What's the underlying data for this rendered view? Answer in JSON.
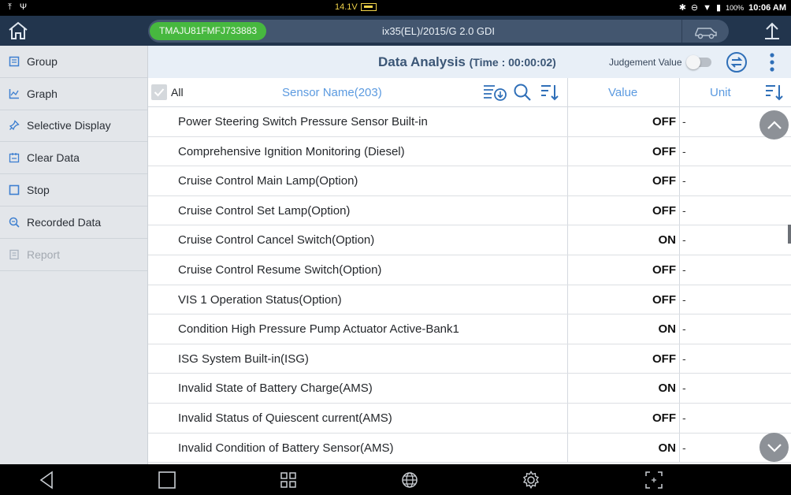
{
  "status_bar": {
    "voltage": "14.1V",
    "battery": "100%",
    "time": "10:06 AM"
  },
  "vehicle": {
    "vin": "TMAJU81FMFJ733883",
    "name": "ix35(EL)/2015/G 2.0 GDI"
  },
  "sidebar": {
    "items": [
      {
        "label": "Group",
        "icon": "group-icon",
        "disabled": false
      },
      {
        "label": "Graph",
        "icon": "graph-icon",
        "disabled": false
      },
      {
        "label": "Selective Display",
        "icon": "pin-icon",
        "disabled": false
      },
      {
        "label": "Clear Data",
        "icon": "clear-data-icon",
        "disabled": false
      },
      {
        "label": "Stop",
        "icon": "stop-icon",
        "disabled": false
      },
      {
        "label": "Recorded Data",
        "icon": "recorded-data-icon",
        "disabled": false
      },
      {
        "label": "Report",
        "icon": "report-icon",
        "disabled": true
      }
    ]
  },
  "header": {
    "title": "Data Analysis",
    "time_label": "(Time : 00:00:02)",
    "judgement_label": "Judgement Value",
    "judgement_enabled": false
  },
  "columns": {
    "all_label": "All",
    "sensor_name": "Sensor Name(203)",
    "value": "Value",
    "unit": "Unit"
  },
  "rows": [
    {
      "name": "Power Steering Switch Pressure Sensor Built-in",
      "value": "OFF",
      "unit": "-"
    },
    {
      "name": "Comprehensive Ignition Monitoring (Diesel)",
      "value": "OFF",
      "unit": "-"
    },
    {
      "name": "Cruise Control Main Lamp(Option)",
      "value": "OFF",
      "unit": "-"
    },
    {
      "name": "Cruise Control Set Lamp(Option)",
      "value": "OFF",
      "unit": "-"
    },
    {
      "name": "Cruise Control Cancel Switch(Option)",
      "value": "ON",
      "unit": "-"
    },
    {
      "name": "Cruise Control Resume Switch(Option)",
      "value": "OFF",
      "unit": "-"
    },
    {
      "name": "VIS 1 Operation Status(Option)",
      "value": "OFF",
      "unit": "-"
    },
    {
      "name": "Condition High Pressure Pump Actuator Active-Bank1",
      "value": "ON",
      "unit": "-"
    },
    {
      "name": "ISG System Built-in(ISG)",
      "value": "OFF",
      "unit": "-"
    },
    {
      "name": "Invalid State of Battery Charge(AMS)",
      "value": "ON",
      "unit": "-"
    },
    {
      "name": "Invalid Status of Quiescent current(AMS)",
      "value": "OFF",
      "unit": "-"
    },
    {
      "name": "Invalid Condition of Battery Sensor(AMS)",
      "value": "ON",
      "unit": "-"
    }
  ],
  "colors": {
    "topbar": "#22354d",
    "vin_badge": "#47b83f",
    "header_bg": "#e8eff7",
    "column_header_text": "#5b9ae0",
    "sidebar_bg": "#e3e6ea"
  }
}
